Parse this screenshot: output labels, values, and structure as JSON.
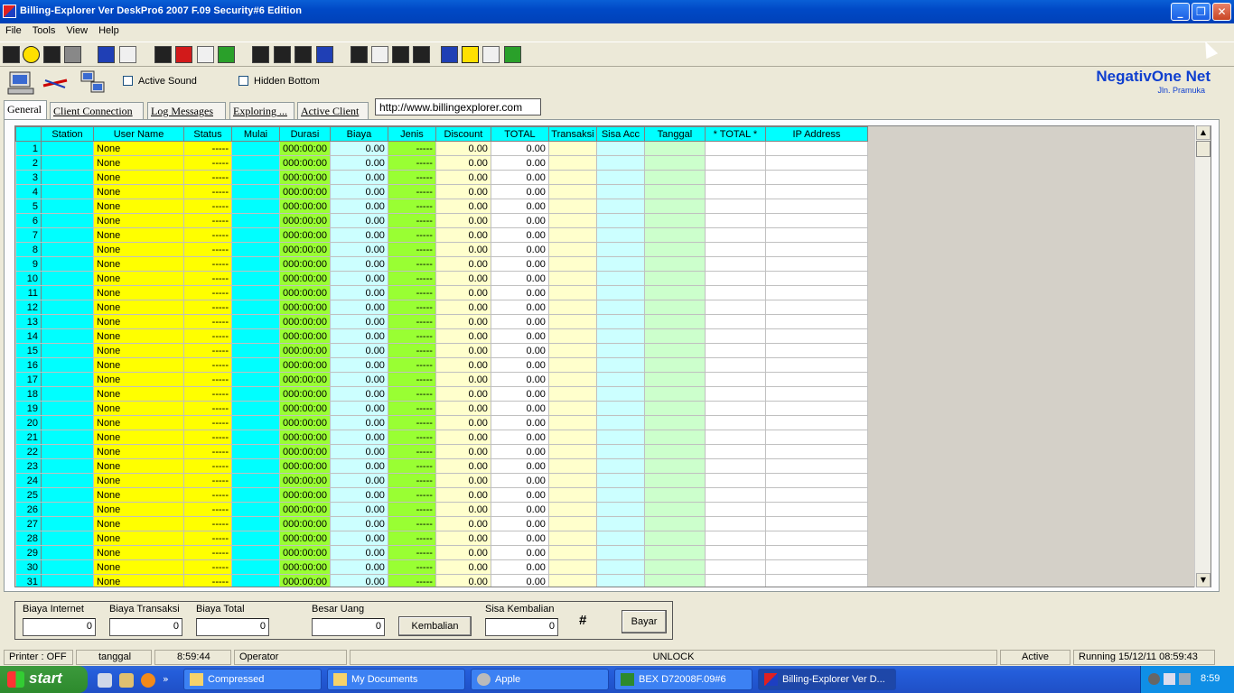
{
  "window": {
    "title": "Billing-Explorer Ver DeskPro6 2007 F.09 Security#6 Edition"
  },
  "menu": [
    "File",
    "Tools",
    "View",
    "Help"
  ],
  "options": {
    "active_sound": "Active Sound",
    "hidden_bottom": "Hidden Bottom"
  },
  "brand": {
    "name": "NegativOne Net",
    "sub": "Jln. Pramuka"
  },
  "tabs": [
    "General",
    "Client Connection",
    "Log Messages",
    "Exploring ...",
    "Active Client"
  ],
  "url": "http://www.billingexplorer.com",
  "grid": {
    "columns": [
      "Station",
      "User Name",
      "Status",
      "Mulai",
      "Durasi",
      "Biaya",
      "Jenis",
      "Discount",
      "TOTAL",
      "Transaksi",
      "Sisa Acc",
      "Tanggal",
      "* TOTAL *",
      "IP Address"
    ],
    "default_row": {
      "user": "None",
      "status": "-----",
      "durasi": "000:00:00",
      "biaya": "0.00",
      "jenis": "-----",
      "discount": "0.00",
      "total": "0.00"
    },
    "rows": [
      1,
      2,
      3,
      4,
      5,
      6,
      7,
      8,
      9,
      10,
      11,
      12,
      13,
      14,
      15,
      16,
      17,
      18,
      19,
      20,
      21,
      22,
      23,
      24,
      25,
      26,
      27,
      28,
      29,
      30,
      31
    ]
  },
  "payment": {
    "biaya_internet_label": "Biaya Internet",
    "biaya_internet": "0",
    "biaya_transaksi_label": "Biaya Transaksi",
    "biaya_transaksi": "0",
    "biaya_total_label": "Biaya Total",
    "biaya_total": "0",
    "besar_uang_label": "Besar Uang",
    "besar_uang": "0",
    "kembalian_button": "Kembalian",
    "sisa_kembalian_label": "Sisa Kembalian",
    "sisa_kembalian": "0",
    "hash": "#",
    "bayar_button": "Bayar"
  },
  "status": {
    "printer": "Printer : OFF",
    "tanggal": "tanggal",
    "time": "8:59:44",
    "operator": "Operator",
    "lock": "UNLOCK",
    "active": "Active",
    "running": "Running 15/12/11  08:59:43"
  },
  "taskbar": {
    "start": "start",
    "buttons": [
      "Compressed",
      "My Documents",
      "Apple",
      "BEX D72008F.09#6",
      "Billing-Explorer Ver D..."
    ],
    "clock": "8:59"
  }
}
